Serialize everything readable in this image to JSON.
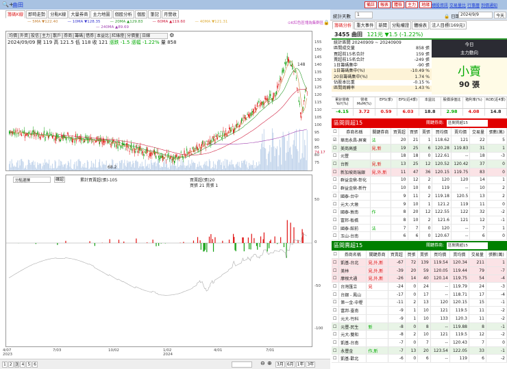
{
  "app": {
    "title": "曲田",
    "zoom_icon": "zoom-in-icon"
  },
  "left_tabs": [
    "籌碼K線",
    "即時走勢",
    "分點K線",
    "大量券商",
    "主力地圖",
    "個股分析",
    "個股",
    "筆記",
    "月營收"
  ],
  "ma_legend": [
    {
      "label": "5MA ▼122.40",
      "color": "#c8863a"
    },
    {
      "label": "10MA ▼128.35",
      "color": "#3a3ad0"
    },
    {
      "label": "20MA ▲129.83",
      "color": "#2a9a2a"
    },
    {
      "label": "60MA ▲119.60",
      "color": "#d02040"
    },
    {
      "label": "40MA ▼121.31",
      "color": "#e0b040"
    },
    {
      "label": "240MA ▲89.69",
      "color": "#a040b0"
    }
  ],
  "ma_note": "⊙K紅色區塊為集群區",
  "chart_tools": [
    "均價",
    "外資",
    "投信",
    "主力",
    "散戶",
    "券商",
    "籌碼",
    "借券",
    "本益比",
    "紅綠燈",
    "分價量"
  ],
  "chart_period": "日線",
  "ohlc": "2024/09/09 開 119 高 121.5 低 118 收 121",
  "change": "漲跌 -1.5  漲幅 -1.22%",
  "volume": "量 858",
  "price_axis": [
    "155",
    "150",
    "145",
    "140",
    "135",
    "130",
    "125",
    "120",
    "115",
    "110",
    "105",
    "100",
    "95",
    "90",
    "85",
    "80",
    "75"
  ],
  "price_marks": {
    "high": "148",
    "low": "68.2",
    "last": "74.17"
  },
  "lower": {
    "select": "分點選擇",
    "button": "確認",
    "legend1": "累計買賣超(張)-105",
    "legend2": "買賣超(張)20",
    "legend3": "買張 21 賣張 1",
    "axis": [
      "50",
      "0",
      "-50",
      "-100"
    ]
  },
  "date_axis": [
    "4/07\n2023",
    "7/03",
    "10/02",
    "1/02\n2024",
    "4/01",
    "7/01"
  ],
  "pages": [
    "1",
    "2",
    "3",
    "4",
    "5",
    "6"
  ],
  "range_buttons": [
    "3月",
    "6月",
    "1年",
    "3年"
  ],
  "right": {
    "buttons": [
      "備註",
      "報表",
      "體檢",
      "主力",
      "地緣"
    ],
    "links": [
      "總股資訊",
      "交易量比",
      "行事曆",
      "到價通知"
    ],
    "days_label": "統計天數",
    "days_value": "1",
    "date_label": "日期",
    "date_value": "2024/9/9",
    "today": "今天",
    "tabs": [
      "籌碼分析",
      "重大事件",
      "新聞",
      "分點權證",
      "體檢表",
      "法人目標(169元)"
    ],
    "stock": {
      "code_name": "3455 曲田",
      "price": "121元",
      "change": "▼1.5 (-1.22%)"
    },
    "stats": [
      {
        "k": "統計區間  20240909 ~ 20240909",
        "v": ""
      },
      {
        "k": "區間成交量",
        "v": "858 張"
      },
      {
        "k": "買超前15名合計",
        "v": "159 張"
      },
      {
        "k": "賣超前15名合計",
        "v": "-249 張"
      },
      {
        "k": "1日籌碼集中",
        "v": "-90 張"
      },
      {
        "k": "1日籌碼集中(%)",
        "v": "-10.49 %"
      },
      {
        "k": "20日籌碼集中(%)",
        "v": "1.74 %"
      },
      {
        "k": "佔股本比重",
        "v": "-0.15 %"
      },
      {
        "k": "區間周轉率",
        "v": "1.43 %"
      }
    ],
    "today_box": {
      "title1": "今日",
      "title2": "主力動向",
      "action": "小賣",
      "amount": "90 張"
    },
    "metrics": [
      {
        "h": "累計營收YoY(%)",
        "v": "-4.15",
        "c": "g"
      },
      {
        "h": "營收MoM(%)",
        "v": "3.72",
        "c": "r"
      },
      {
        "h": "EPS(季)",
        "v": "0.59",
        "c": "r"
      },
      {
        "h": "EPS(近4季)",
        "v": "6.03",
        "c": "r"
      },
      {
        "h": "本益比",
        "v": "18.8",
        "c": ""
      },
      {
        "h": "股價淨值比",
        "v": "2.98",
        "c": "g"
      },
      {
        "h": "殖利率(%)",
        "v": "4.08",
        "c": "r"
      },
      {
        "h": "ROE(近4季)",
        "v": "14.8",
        "c": ""
      }
    ],
    "columns": [
      "券商名稱",
      "關鍵券商",
      "買賣超",
      "買張",
      "賣張",
      "買均價",
      "賣均價",
      "交易量",
      "張數(萬)"
    ],
    "buy": {
      "title": "區間買超15",
      "key_label": "關鍵券商:",
      "key_select": "區間買超15",
      "rows": [
        [
          "華南永昌-屏東",
          "法",
          "20",
          "21",
          "1",
          "118.62",
          "121",
          "22",
          "5",
          ""
        ],
        [
          "美商高盛",
          "見,新",
          "19",
          "25",
          "6",
          "120.28",
          "119.83",
          "31",
          "1",
          "grn"
        ],
        [
          "元豐",
          "",
          "18",
          "18",
          "0",
          "122.61",
          "--",
          "18",
          "-3",
          ""
        ],
        [
          "台新",
          "見,新",
          "13",
          "25",
          "12",
          "120.52",
          "120.42",
          "37",
          "0",
          "grn"
        ],
        [
          "新加坡商瑞銀",
          "見,外,新",
          "11",
          "47",
          "36",
          "120.15",
          "119.75",
          "83",
          "0",
          "pink"
        ],
        [
          "群益金鼎-彰化",
          "",
          "10",
          "12",
          "2",
          "120",
          "120",
          "14",
          "1",
          ""
        ],
        [
          "群益金鼎-新竹",
          "",
          "10",
          "10",
          "0",
          "119",
          "--",
          "10",
          "2",
          ""
        ],
        [
          "國泰-台中",
          "",
          "9",
          "11",
          "2",
          "119.18",
          "120.5",
          "13",
          "2",
          ""
        ],
        [
          "元大-大墩",
          "",
          "9",
          "10",
          "1",
          "121.2",
          "119",
          "11",
          "0",
          ""
        ],
        [
          "國泰-敦南",
          "作",
          "8",
          "20",
          "12",
          "122.55",
          "122",
          "32",
          "-2",
          ""
        ],
        [
          "富邦-板橋",
          "",
          "8",
          "10",
          "2",
          "121.6",
          "121",
          "12",
          "-1",
          ""
        ],
        [
          "國泰-館前",
          "法",
          "7",
          "7",
          "0",
          "120",
          "--",
          "7",
          "1",
          ""
        ],
        [
          "玉山-台南",
          "",
          "6",
          "6",
          "0",
          "120.67",
          "--",
          "6",
          "0",
          ""
        ]
      ]
    },
    "sell": {
      "title": "區間賣超15",
      "key_label": "關鍵券商:",
      "key_select": "區間賣超15",
      "rows": [
        [
          "凱基-台北",
          "見,外,新",
          "-67",
          "72",
          "139",
          "119.54",
          "120.34",
          "211",
          "1",
          "pink"
        ],
        [
          "美林",
          "見,外,新",
          "-39",
          "20",
          "59",
          "120.05",
          "119.44",
          "79",
          "-7",
          "pink"
        ],
        [
          "摩根大通",
          "見,外,新",
          "-26",
          "14",
          "40",
          "120.14",
          "119.75",
          "54",
          "-4",
          "pink"
        ],
        [
          "台灣匯立",
          "見",
          "-24",
          "0",
          "24",
          "--",
          "119.79",
          "24",
          "-3",
          ""
        ],
        [
          "台銀 - 鳳山",
          "",
          "-17",
          "0",
          "17",
          "--",
          "118.71",
          "17",
          "-4",
          ""
        ],
        [
          "第一金-中壢",
          "",
          "-11",
          "2",
          "13",
          "120",
          "120.15",
          "15",
          "-1",
          ""
        ],
        [
          "富邦-臺南",
          "",
          "-9",
          "1",
          "10",
          "121",
          "119.5",
          "11",
          "-2",
          ""
        ],
        [
          "元大-竹科",
          "",
          "-9",
          "1",
          "10",
          "133",
          "120.3",
          "11",
          "-2",
          ""
        ],
        [
          "元豐-民生",
          "新",
          "-8",
          "0",
          "8",
          "--",
          "119.88",
          "8",
          "-1",
          "grn"
        ],
        [
          "元大-雙和",
          "",
          "-8",
          "2",
          "10",
          "121",
          "119.5",
          "12",
          "-2",
          ""
        ],
        [
          "凱基-台南",
          "",
          "-7",
          "0",
          "7",
          "--",
          "120.43",
          "7",
          "0",
          ""
        ],
        [
          "永豐金",
          "作,新",
          "-7",
          "13",
          "20",
          "123.54",
          "122.05",
          "33",
          "-1",
          "grn"
        ],
        [
          "凱基-歡北",
          "",
          "-6",
          "0",
          "6",
          "--",
          "119",
          "6",
          "-2",
          ""
        ]
      ]
    }
  },
  "colors": {
    "up": "#e01010",
    "down": "#10a010",
    "buy_header": "#e00000",
    "sell_header": "#008000",
    "bar": "#a8c2e2"
  }
}
